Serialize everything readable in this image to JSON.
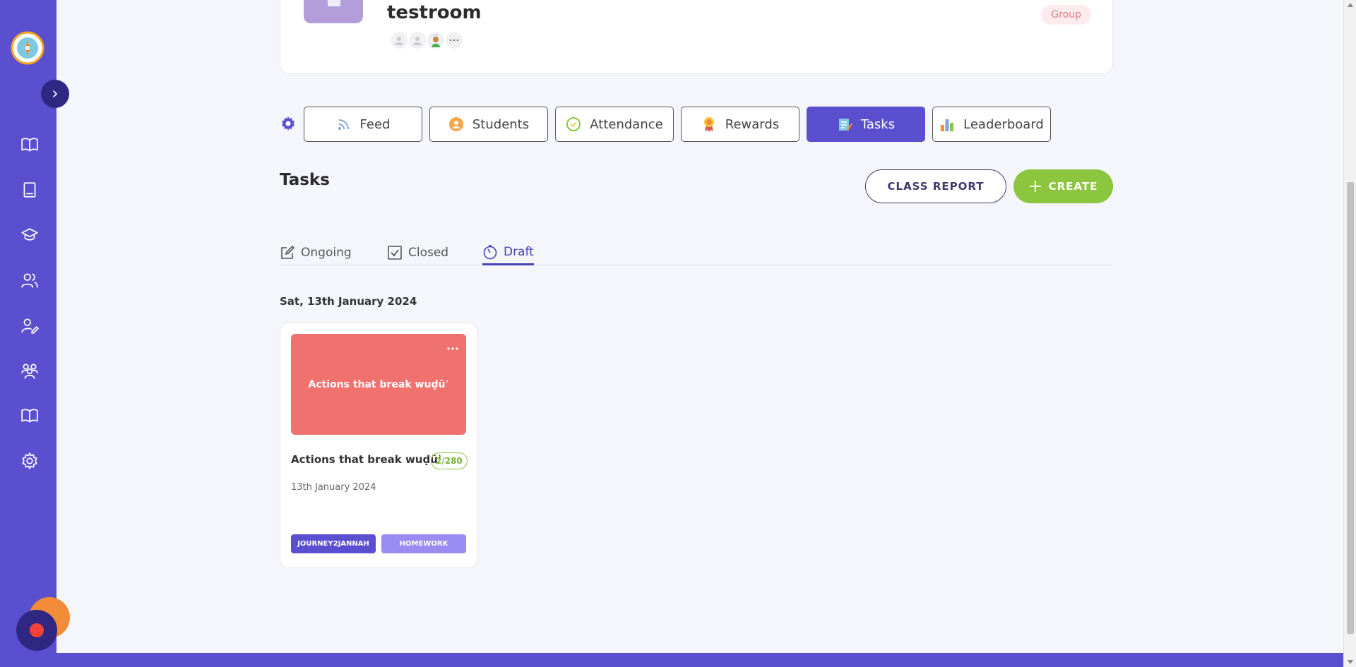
{
  "room": {
    "title": "testroom",
    "badge": "Group"
  },
  "nav_tabs": [
    {
      "label": "Feed",
      "icon": "rss-icon"
    },
    {
      "label": "Students",
      "icon": "student-icon"
    },
    {
      "label": "Attendance",
      "icon": "attendance-icon"
    },
    {
      "label": "Rewards",
      "icon": "rewards-icon"
    },
    {
      "label": "Tasks",
      "icon": "tasks-icon"
    },
    {
      "label": "Leaderboard",
      "icon": "leaderboard-icon"
    }
  ],
  "active_tab": "Tasks",
  "page": {
    "title": "Tasks",
    "class_report_label": "CLASS REPORT",
    "create_label": "CREATE"
  },
  "sub_tabs": [
    {
      "label": "Ongoing",
      "icon": "edit-icon"
    },
    {
      "label": "Closed",
      "icon": "checkbox-icon"
    },
    {
      "label": "Draft",
      "icon": "timer-icon"
    }
  ],
  "active_sub_tab": "Draft",
  "date_group": "Sat, 13th January 2024",
  "task": {
    "thumbnail_text": "Actions that break wuḍūʾ",
    "title": "Actions that break wuḍūʾ",
    "count": "2/280",
    "date": "13th January 2024",
    "tags": [
      "JOURNEY2JANNAH",
      "HOMEWORK"
    ]
  },
  "colors": {
    "primary": "#5a4fcf",
    "accent_green": "#8cc63f",
    "thumbnail": "#f0726f",
    "tag_secondary": "#9b8cf2"
  }
}
